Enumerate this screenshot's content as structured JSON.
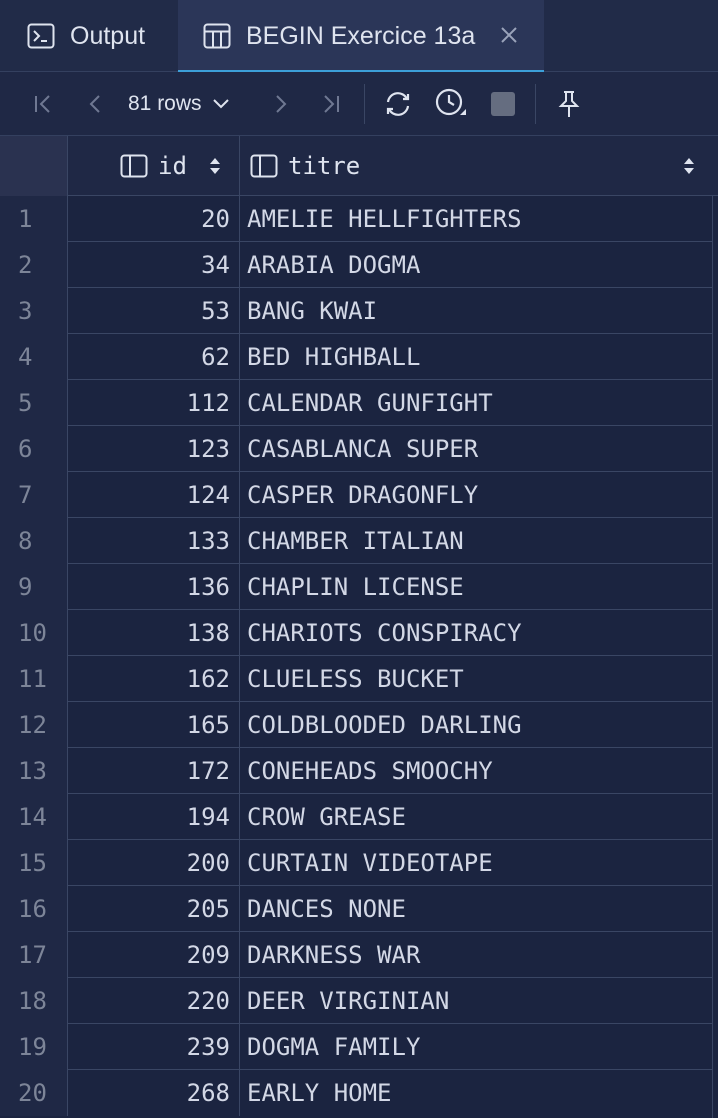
{
  "tabs": [
    {
      "label": "Output",
      "icon": "terminal-icon"
    },
    {
      "label": "BEGIN Exercice 13a",
      "icon": "table-icon",
      "active": true
    }
  ],
  "toolbar": {
    "rows_label": "81 rows"
  },
  "grid": {
    "columns": [
      {
        "name": "id",
        "icon": "column-icon"
      },
      {
        "name": "titre",
        "icon": "column-icon"
      }
    ],
    "rows": [
      {
        "n": "1",
        "id": "20",
        "titre": "AMELIE HELLFIGHTERS"
      },
      {
        "n": "2",
        "id": "34",
        "titre": "ARABIA DOGMA"
      },
      {
        "n": "3",
        "id": "53",
        "titre": "BANG KWAI"
      },
      {
        "n": "4",
        "id": "62",
        "titre": "BED HIGHBALL"
      },
      {
        "n": "5",
        "id": "112",
        "titre": "CALENDAR GUNFIGHT"
      },
      {
        "n": "6",
        "id": "123",
        "titre": "CASABLANCA SUPER"
      },
      {
        "n": "7",
        "id": "124",
        "titre": "CASPER DRAGONFLY"
      },
      {
        "n": "8",
        "id": "133",
        "titre": "CHAMBER ITALIAN"
      },
      {
        "n": "9",
        "id": "136",
        "titre": "CHAPLIN LICENSE"
      },
      {
        "n": "10",
        "id": "138",
        "titre": "CHARIOTS CONSPIRACY"
      },
      {
        "n": "11",
        "id": "162",
        "titre": "CLUELESS BUCKET"
      },
      {
        "n": "12",
        "id": "165",
        "titre": "COLDBLOODED DARLING"
      },
      {
        "n": "13",
        "id": "172",
        "titre": "CONEHEADS SMOOCHY"
      },
      {
        "n": "14",
        "id": "194",
        "titre": "CROW GREASE"
      },
      {
        "n": "15",
        "id": "200",
        "titre": "CURTAIN VIDEOTAPE"
      },
      {
        "n": "16",
        "id": "205",
        "titre": "DANCES NONE"
      },
      {
        "n": "17",
        "id": "209",
        "titre": "DARKNESS WAR"
      },
      {
        "n": "18",
        "id": "220",
        "titre": "DEER VIRGINIAN"
      },
      {
        "n": "19",
        "id": "239",
        "titre": "DOGMA FAMILY"
      },
      {
        "n": "20",
        "id": "268",
        "titre": "EARLY HOME"
      }
    ]
  },
  "colors": {
    "background": "#1b2440",
    "accent": "#3c9fd8",
    "text": "#d3d8e6"
  }
}
